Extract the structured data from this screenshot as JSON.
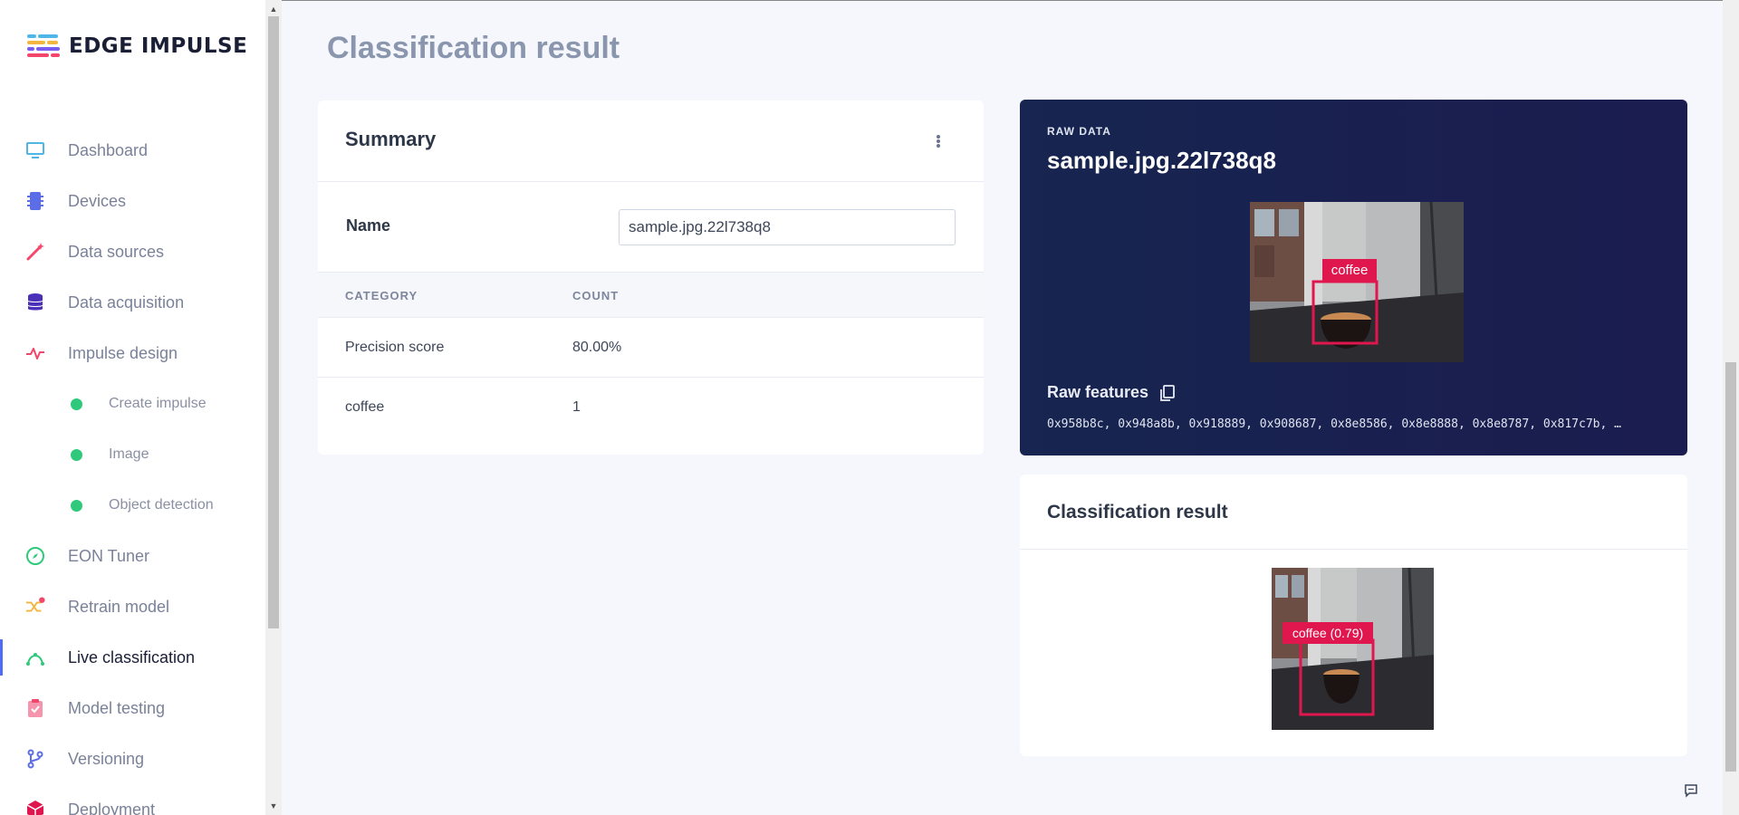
{
  "app": {
    "brand": "EDGE IMPULSE"
  },
  "sidebar": {
    "items": [
      {
        "label": "Dashboard",
        "icon": "monitor-icon"
      },
      {
        "label": "Devices",
        "icon": "chip-icon"
      },
      {
        "label": "Data sources",
        "icon": "magic-wand-icon"
      },
      {
        "label": "Data acquisition",
        "icon": "database-icon"
      },
      {
        "label": "Impulse design",
        "icon": "pulse-icon"
      },
      {
        "label": "Create impulse",
        "icon": "status-dot-icon"
      },
      {
        "label": "Image",
        "icon": "status-dot-icon"
      },
      {
        "label": "Object detection",
        "icon": "status-dot-icon"
      },
      {
        "label": "EON Tuner",
        "icon": "compass-icon"
      },
      {
        "label": "Retrain model",
        "icon": "shuffle-icon"
      },
      {
        "label": "Live classification",
        "icon": "bezier-icon"
      },
      {
        "label": "Model testing",
        "icon": "clipboard-check-icon"
      },
      {
        "label": "Versioning",
        "icon": "git-branch-icon"
      },
      {
        "label": "Deployment",
        "icon": "cube-icon"
      }
    ]
  },
  "main": {
    "page_title": "Classification result",
    "summary": {
      "title": "Summary",
      "name_label": "Name",
      "name_value": "sample.jpg.22l738q8",
      "columns": [
        "CATEGORY",
        "COUNT"
      ],
      "rows": [
        {
          "category": "Precision score",
          "count": "80.00%"
        },
        {
          "category": "coffee",
          "count": "1"
        }
      ]
    },
    "raw_data": {
      "label": "RAW DATA",
      "sample_name": "sample.jpg.22l738q8",
      "bbox_label": "coffee",
      "features_title": "Raw features",
      "features_values": "0x958b8c, 0x948a8b, 0x918889, 0x908687, 0x8e8586, 0x8e8888, 0x8e8787, 0x817c7b, …"
    },
    "classification": {
      "title": "Classification result",
      "bbox_label": "coffee (0.79)"
    }
  },
  "colors": {
    "accent": "#4f6cf7",
    "bbox": "#e0174f",
    "status_green": "#2ec97b",
    "raw_bg": "#172550"
  }
}
